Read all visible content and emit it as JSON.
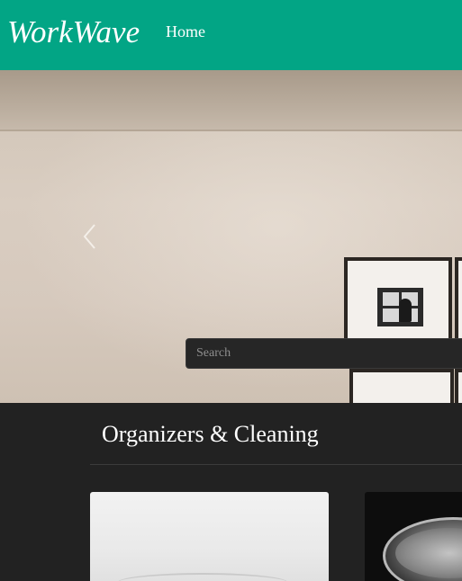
{
  "header": {
    "brand": "WorkWave",
    "nav": [
      {
        "label": "Home"
      }
    ]
  },
  "hero": {
    "search": {
      "placeholder": "Search",
      "value": ""
    },
    "prev_icon": "chevron-left-icon"
  },
  "section": {
    "title": "Organizers & Cleaning"
  },
  "colors": {
    "header_bg": "#02a585",
    "page_bg": "#222222",
    "text": "#ffffff"
  }
}
